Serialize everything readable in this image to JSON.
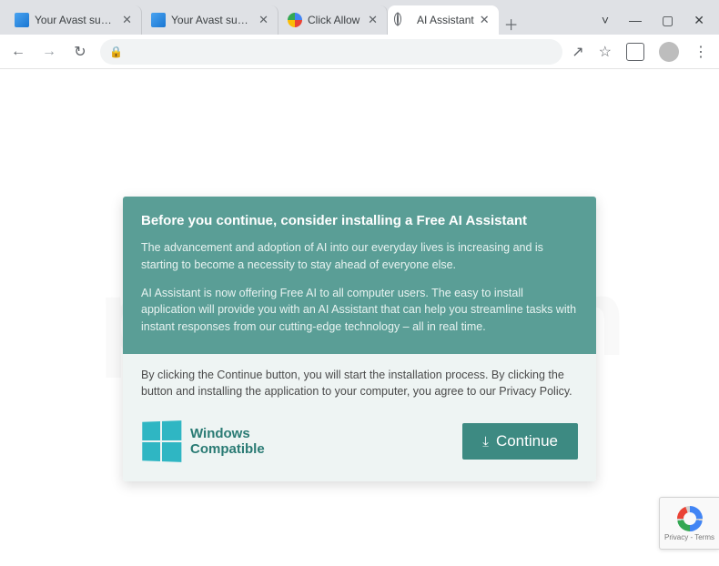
{
  "tabs": [
    {
      "title": "Your Avast subscription",
      "icon": "blue",
      "active": false
    },
    {
      "title": "Your Avast subscription",
      "icon": "blue",
      "active": false
    },
    {
      "title": "Click Allow",
      "icon": "recaptcha",
      "active": false
    },
    {
      "title": "AI Assistant",
      "icon": "globe",
      "active": true
    }
  ],
  "window_controls": {
    "drop": "˅",
    "min": "—",
    "max": "▢",
    "close": "✕"
  },
  "toolbar": {
    "back": "←",
    "forward": "→",
    "reload": "↻",
    "share": "↗",
    "star": "☆",
    "ext": "",
    "menu": "⋮"
  },
  "card": {
    "heading": "Before you continue, consider installing a Free AI Assistant",
    "p1": "The advancement and adoption of AI into our everyday lives is increasing and is starting to become a necessity to stay ahead of everyone else.",
    "p2": "AI Assistant is now offering Free AI to all computer users. The easy to install application will provide you with an AI Assistant that can help you streamline tasks with instant responses from our cutting-edge technology – all in real time.",
    "disclaimer": "By clicking the Continue button, you will start the installation process. By clicking the button and installing the application to your computer, you agree to our Privacy Policy.",
    "windows_line1": "Windows",
    "windows_line2": "Compatible",
    "continue": "Continue"
  },
  "recaptcha": {
    "line": "Privacy  -  Terms"
  },
  "watermark": "pcrisk.com"
}
